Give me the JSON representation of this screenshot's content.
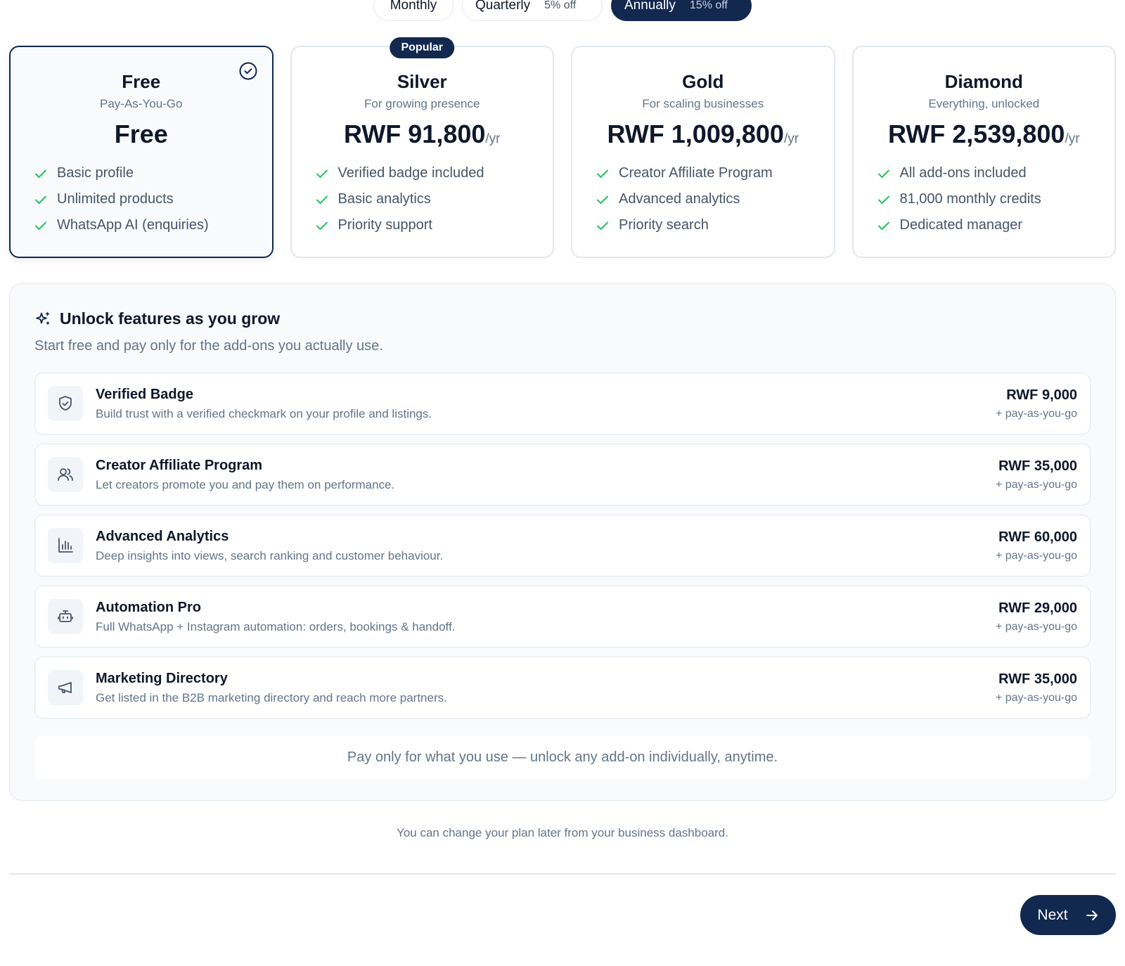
{
  "billing": {
    "monthly": "Monthly",
    "quarterly": "Quarterly",
    "quarterly_discount": "5% off",
    "annually": "Annually",
    "annually_discount": "15% off",
    "selected": "Annually"
  },
  "plans": [
    {
      "name": "Free",
      "subtitle": "Pay-As-You-Go",
      "price": "Free",
      "period": "",
      "features": [
        "Basic profile",
        "Unlimited products",
        "WhatsApp AI (enquiries)"
      ]
    },
    {
      "name": "Silver",
      "subtitle": "For growing presence",
      "price": "RWF 91,800",
      "period": "/yr",
      "badge": "Popular",
      "features": [
        "Verified badge included",
        "Basic analytics",
        "Priority support"
      ]
    },
    {
      "name": "Gold",
      "subtitle": "For scaling businesses",
      "price": "RWF 1,009,800",
      "period": "/yr",
      "features": [
        "Creator Affiliate Program",
        "Advanced analytics",
        "Priority search"
      ]
    },
    {
      "name": "Diamond",
      "subtitle": "Everything, unlocked",
      "price": "RWF 2,539,800",
      "period": "/yr",
      "features": [
        "All add-ons included",
        "81,000 monthly credits",
        "Dedicated manager"
      ]
    }
  ],
  "addons": {
    "title": "Unlock features as you grow",
    "subtitle": "Start free and pay only for the add-ons you actually use.",
    "items": [
      {
        "icon": "shield-check-icon",
        "name": "Verified Badge",
        "description": "Build trust with a verified checkmark on your profile and listings.",
        "price": "RWF 9,000",
        "billing": "+ pay-as-you-go"
      },
      {
        "icon": "users-icon",
        "name": "Creator Affiliate Program",
        "description": "Let creators promote you and pay them on performance.",
        "price": "RWF 35,000",
        "billing": "+ pay-as-you-go"
      },
      {
        "icon": "bar-chart-icon",
        "name": "Advanced Analytics",
        "description": "Deep insights into views, search ranking and customer behaviour.",
        "price": "RWF 60,000",
        "billing": "+ pay-as-you-go"
      },
      {
        "icon": "bot-icon",
        "name": "Automation Pro",
        "description": "Full WhatsApp + Instagram automation: orders, bookings & handoff.",
        "price": "RWF 29,000",
        "billing": "+ pay-as-you-go"
      },
      {
        "icon": "megaphone-icon",
        "name": "Marketing Directory",
        "description": "Get listed in the B2B marketing directory and reach more partners.",
        "price": "RWF 35,000",
        "billing": "+ pay-as-you-go"
      }
    ],
    "footnote": "Pay only for what you use — unlock any add-on individually, anytime."
  },
  "change_note": "You can change your plan later from your business dashboard.",
  "next_label": "Next",
  "colors": {
    "brand": "#12284f",
    "check": "#22c55e",
    "muted": "#64748b",
    "border": "#e2e8f0"
  }
}
